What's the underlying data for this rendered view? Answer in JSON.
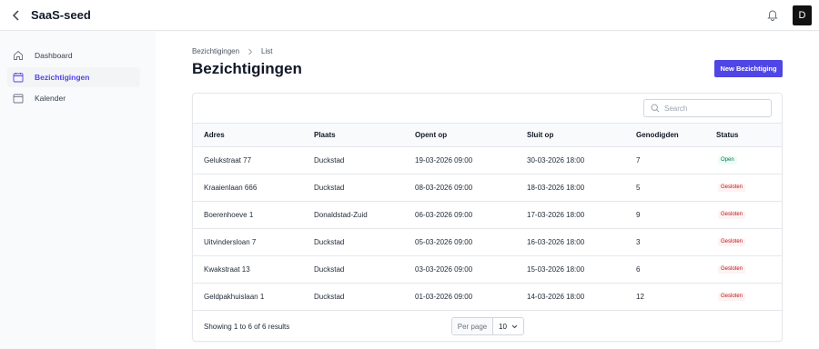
{
  "app": {
    "title": "SaaS-seed",
    "user_initial": "D"
  },
  "sidebar": {
    "items": [
      {
        "label": "Dashboard",
        "icon": "home-icon"
      },
      {
        "label": "Bezichtigingen",
        "icon": "calendar-icon",
        "active": true
      },
      {
        "label": "Kalender",
        "icon": "calendar-icon"
      }
    ]
  },
  "breadcrumb": [
    "Bezichtigingen",
    "List"
  ],
  "page": {
    "title": "Bezichtigingen",
    "new_button": "New Bezichtiging"
  },
  "search": {
    "placeholder": "Search"
  },
  "table": {
    "columns": [
      "Adres",
      "Plaats",
      "Opent op",
      "Sluit op",
      "Genodigden",
      "Status"
    ],
    "rows": [
      {
        "adres": "Gelukstraat 77",
        "plaats": "Duckstad",
        "opent": "19-03-2026 09:00",
        "sluit": "30-03-2026 18:00",
        "genodigden": "7",
        "status": "Open"
      },
      {
        "adres": "Kraaienlaan 666",
        "plaats": "Duckstad",
        "opent": "08-03-2026 09:00",
        "sluit": "18-03-2026 18:00",
        "genodigden": "5",
        "status": "Gesloten"
      },
      {
        "adres": "Boerenhoeve 1",
        "plaats": "Donaldstad-Zuid",
        "opent": "06-03-2026 09:00",
        "sluit": "17-03-2026 18:00",
        "genodigden": "9",
        "status": "Gesloten"
      },
      {
        "adres": "Uitvindersloan 7",
        "plaats": "Duckstad",
        "opent": "05-03-2026 09:00",
        "sluit": "16-03-2026 18:00",
        "genodigden": "3",
        "status": "Gesloten"
      },
      {
        "adres": "Kwakstraat 13",
        "plaats": "Duckstad",
        "opent": "03-03-2026 09:00",
        "sluit": "15-03-2026 18:00",
        "genodigden": "6",
        "status": "Gesloten"
      },
      {
        "adres": "Geldpakhuislaan 1",
        "plaats": "Duckstad",
        "opent": "01-03-2026 09:00",
        "sluit": "14-03-2026 18:00",
        "genodigden": "12",
        "status": "Gesloten"
      }
    ]
  },
  "footer": {
    "results": "Showing 1 to 6 of 6 results",
    "per_page_label": "Per page",
    "per_page_value": "10"
  },
  "colors": {
    "accent": "#4f46e5",
    "open_text": "#047857",
    "closed_text": "#b91c1c"
  }
}
